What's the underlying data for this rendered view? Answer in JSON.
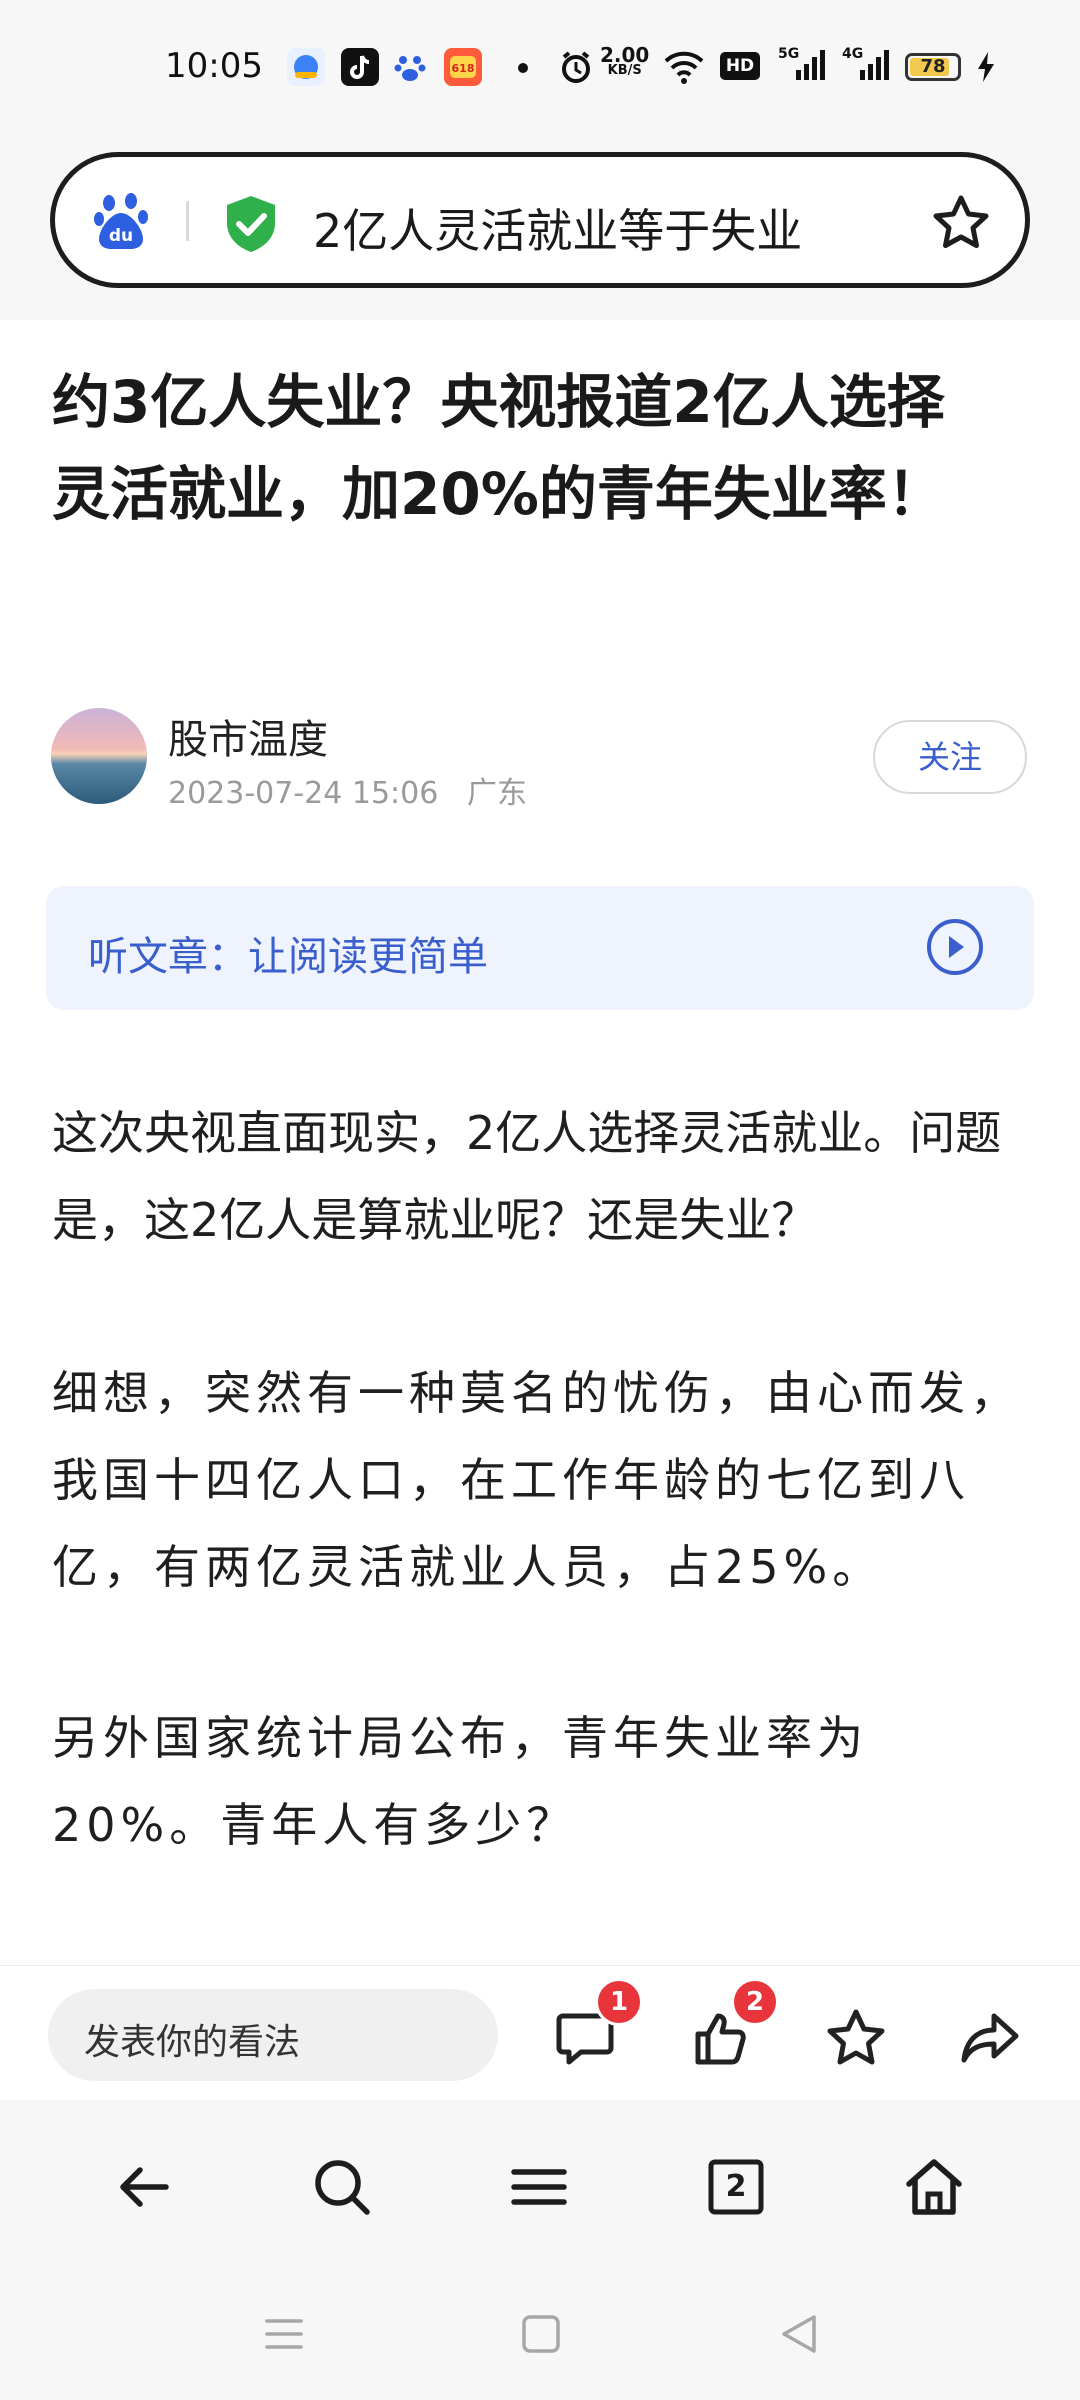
{
  "status_bar": {
    "time": "10:05",
    "net_speed_value": "2.00",
    "net_speed_unit": "KB/S",
    "hd_label": "HD",
    "signal1_label": "5G",
    "signal2_label": "4G",
    "battery_level": "78"
  },
  "search": {
    "query": "2亿人灵活就业等于失业",
    "logo": "baidu-paw-icon",
    "security": "shield-check-icon",
    "bookmark": "star-icon"
  },
  "article": {
    "title": "约3亿人失业？央视报道2亿人选择灵活就业，加20%的青年失业率！",
    "author": "股市温度",
    "date": "2023-07-24 15:06",
    "location": "广东",
    "follow_label": "关注",
    "listen_label": "听文章：让阅读更简单",
    "paragraphs": [
      "这次央视直面现实，2亿人选择灵活就业。问题是，这2亿人是算就业呢？还是失业？",
      "细想，突然有一种莫名的忧伤，由心而发，我国十四亿人口，在工作年龄的七亿到八亿，有两亿灵活就业人员，占25%。",
      "另外国家统计局公布，青年失业率为20%。青年人有多少？"
    ]
  },
  "action_bar": {
    "comment_placeholder": "发表你的看法",
    "comment_count": "1",
    "like_count": "2"
  },
  "nav": {
    "tab_count": "2"
  },
  "colors": {
    "accent": "#3a5fcd",
    "badge": "#e8353b",
    "shield": "#2fb04a",
    "baidu_blue": "#2e5fe0"
  }
}
